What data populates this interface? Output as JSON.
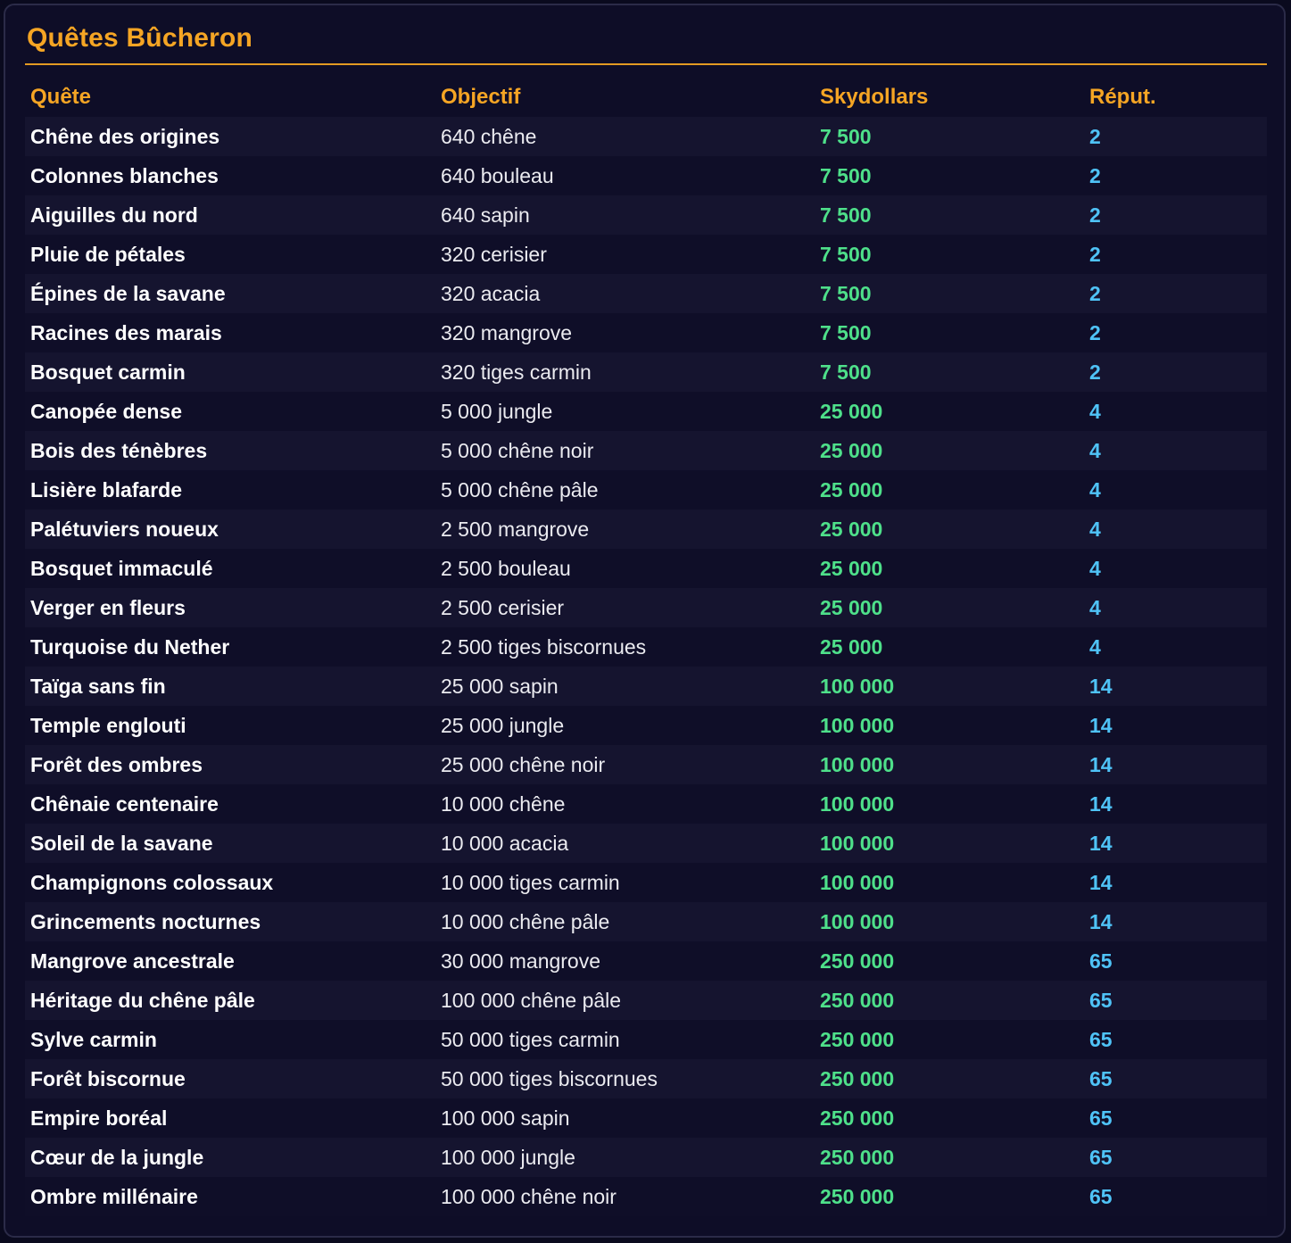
{
  "title": "Quêtes Bûcheron",
  "headers": {
    "quest": "Quête",
    "objective": "Objectif",
    "money": "Skydollars",
    "rep": "Réput."
  },
  "colors": {
    "accent": "#f5a524",
    "money": "#4ee08a",
    "reputation": "#4fc3f7",
    "background": "#0e0d27"
  },
  "rows": [
    {
      "name": "Chêne des origines",
      "objective": "640 chêne",
      "money": "7 500",
      "rep": "2"
    },
    {
      "name": "Colonnes blanches",
      "objective": "640 bouleau",
      "money": "7 500",
      "rep": "2"
    },
    {
      "name": "Aiguilles du nord",
      "objective": "640 sapin",
      "money": "7 500",
      "rep": "2"
    },
    {
      "name": "Pluie de pétales",
      "objective": "320 cerisier",
      "money": "7 500",
      "rep": "2"
    },
    {
      "name": "Épines de la savane",
      "objective": "320 acacia",
      "money": "7 500",
      "rep": "2"
    },
    {
      "name": "Racines des marais",
      "objective": "320 mangrove",
      "money": "7 500",
      "rep": "2"
    },
    {
      "name": "Bosquet carmin",
      "objective": "320 tiges carmin",
      "money": "7 500",
      "rep": "2"
    },
    {
      "name": "Canopée dense",
      "objective": "5 000 jungle",
      "money": "25 000",
      "rep": "4"
    },
    {
      "name": "Bois des ténèbres",
      "objective": "5 000 chêne noir",
      "money": "25 000",
      "rep": "4"
    },
    {
      "name": "Lisière blafarde",
      "objective": "5 000 chêne pâle",
      "money": "25 000",
      "rep": "4"
    },
    {
      "name": "Palétuviers noueux",
      "objective": "2 500 mangrove",
      "money": "25 000",
      "rep": "4"
    },
    {
      "name": "Bosquet immaculé",
      "objective": "2 500 bouleau",
      "money": "25 000",
      "rep": "4"
    },
    {
      "name": "Verger en fleurs",
      "objective": "2 500 cerisier",
      "money": "25 000",
      "rep": "4"
    },
    {
      "name": "Turquoise du Nether",
      "objective": "2 500 tiges biscornues",
      "money": "25 000",
      "rep": "4"
    },
    {
      "name": "Taïga sans fin",
      "objective": "25 000 sapin",
      "money": "100 000",
      "rep": "14"
    },
    {
      "name": "Temple englouti",
      "objective": "25 000 jungle",
      "money": "100 000",
      "rep": "14"
    },
    {
      "name": "Forêt des ombres",
      "objective": "25 000 chêne noir",
      "money": "100 000",
      "rep": "14"
    },
    {
      "name": "Chênaie centenaire",
      "objective": "10 000 chêne",
      "money": "100 000",
      "rep": "14"
    },
    {
      "name": "Soleil de la savane",
      "objective": "10 000 acacia",
      "money": "100 000",
      "rep": "14"
    },
    {
      "name": "Champignons colossaux",
      "objective": "10 000 tiges carmin",
      "money": "100 000",
      "rep": "14"
    },
    {
      "name": "Grincements nocturnes",
      "objective": "10 000 chêne pâle",
      "money": "100 000",
      "rep": "14"
    },
    {
      "name": "Mangrove ancestrale",
      "objective": "30 000 mangrove",
      "money": "250 000",
      "rep": "65"
    },
    {
      "name": "Héritage du chêne pâle",
      "objective": "100 000 chêne pâle",
      "money": "250 000",
      "rep": "65"
    },
    {
      "name": "Sylve carmin",
      "objective": "50 000 tiges carmin",
      "money": "250 000",
      "rep": "65"
    },
    {
      "name": "Forêt biscornue",
      "objective": "50 000 tiges biscornues",
      "money": "250 000",
      "rep": "65"
    },
    {
      "name": "Empire boréal",
      "objective": "100 000 sapin",
      "money": "250 000",
      "rep": "65"
    },
    {
      "name": "Cœur de la jungle",
      "objective": "100 000 jungle",
      "money": "250 000",
      "rep": "65"
    },
    {
      "name": "Ombre millénaire",
      "objective": "100 000 chêne noir",
      "money": "250 000",
      "rep": "65"
    }
  ]
}
